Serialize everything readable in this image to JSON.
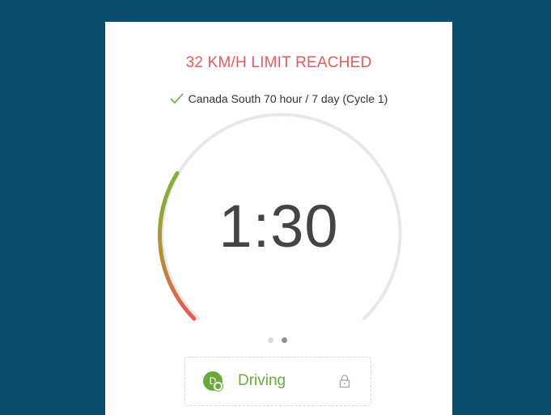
{
  "alert": {
    "title": "32 KM/H LIMIT REACHED",
    "color": "#e35b5b"
  },
  "cycle": {
    "icon": "check-icon",
    "label": "Canada South 70 hour / 7 day (Cycle 1)"
  },
  "gauge": {
    "remaining_time": "1:30",
    "progress_colors": [
      "#e35b5b",
      "#7db33a"
    ],
    "track_color": "#e8e8e8"
  },
  "pager": {
    "count": 2,
    "active_index": 1
  },
  "status": {
    "avatar_initial": "D",
    "label": "Driving",
    "accent_color": "#6aaa3a",
    "lock_icon": "lock-icon"
  }
}
